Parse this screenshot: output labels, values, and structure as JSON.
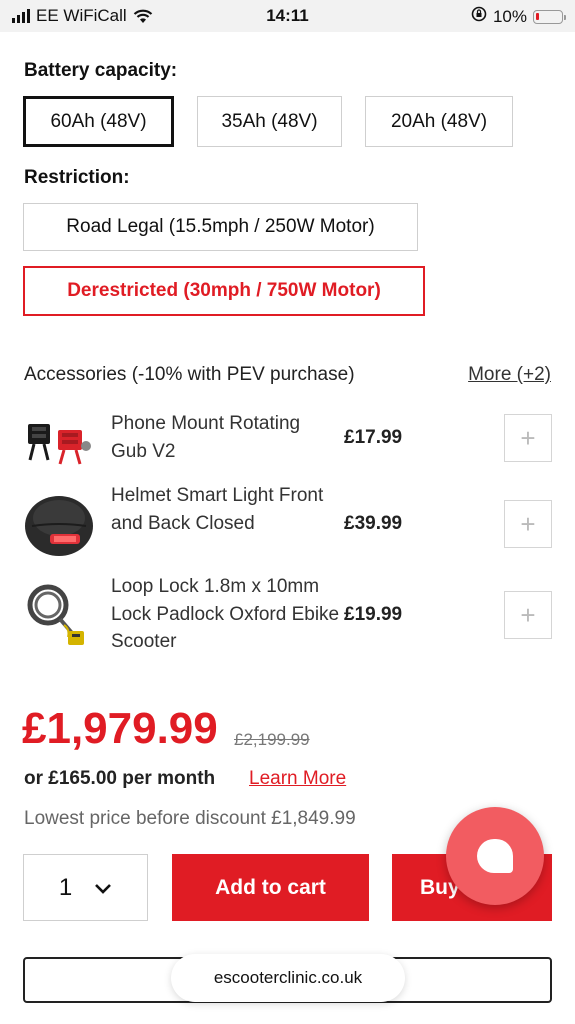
{
  "status_bar": {
    "carrier": "EE WiFiCall",
    "time": "14:11",
    "battery_percent": "10%",
    "battery_level": 0.1,
    "battery_color": "#e01c24",
    "icons": [
      "signal-icon",
      "wifi-icon",
      "orientation-lock-icon",
      "battery-icon"
    ]
  },
  "battery_section": {
    "label": "Battery capacity:",
    "options": [
      {
        "label": "60Ah (48V)",
        "selected": true
      },
      {
        "label": "35Ah (48V)",
        "selected": false
      },
      {
        "label": "20Ah (48V)",
        "selected": false
      }
    ]
  },
  "restriction_section": {
    "label": "Restriction:",
    "options": [
      {
        "label": "Road Legal (15.5mph / 250W Motor)",
        "selected": false
      },
      {
        "label": "Derestricted (30mph / 750W Motor)",
        "selected": true
      }
    ]
  },
  "accessories": {
    "header": "Accessories (-10% with PEV purchase)",
    "more_link": "More (+2)",
    "items": [
      {
        "name": "Phone Mount Rotating Gub V2",
        "price": "£17.99",
        "icon": "phone-mount-icon",
        "add_icon": "plus-icon"
      },
      {
        "name": "Helmet Smart Light Front and Back Closed",
        "price": "£39.99",
        "icon": "helmet-icon",
        "add_icon": "plus-icon"
      },
      {
        "name": "Loop Lock 1.8m x 10mm Lock Padlock Oxford Ebike Scooter",
        "price": "£19.99",
        "icon": "lock-icon",
        "add_icon": "plus-icon"
      }
    ]
  },
  "pricing": {
    "price": "£1,979.99",
    "old_price": "£2,199.99",
    "monthly": "or £165.00 per month",
    "learn_more": "Learn More",
    "lowest": "Lowest price before discount £1,849.99"
  },
  "purchase": {
    "quantity": "1",
    "add_to_cart": "Add to cart",
    "buy": "Buy"
  },
  "browser": {
    "url": "escooterclinic.co.uk"
  },
  "colors": {
    "accent": "#e01c24",
    "chat": "#f25c61"
  }
}
